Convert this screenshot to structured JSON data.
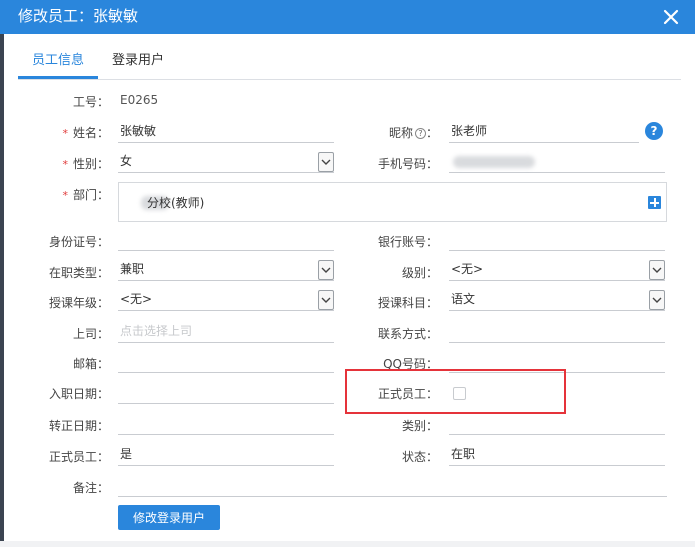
{
  "dialog": {
    "title": "修改员工：张敏敏"
  },
  "tabs": [
    {
      "label": "员工信息"
    },
    {
      "label": "登录用户"
    }
  ],
  "form": {
    "employee_no": {
      "label": "工号：",
      "value": "E0265"
    },
    "name": {
      "label": "姓名：",
      "value": "张敏敏"
    },
    "nickname": {
      "label": "昵称",
      "label_suffix": "：",
      "value": "张老师"
    },
    "gender": {
      "label": "性别：",
      "value": "女"
    },
    "phone": {
      "label": "手机号码：",
      "value": ""
    },
    "department": {
      "label": "部门：",
      "value": "分校(教师)"
    },
    "id_card": {
      "label": "身份证号：",
      "value": ""
    },
    "bank_account": {
      "label": "银行账号：",
      "value": ""
    },
    "job_type": {
      "label": "在职类型：",
      "value": "兼职"
    },
    "level": {
      "label": "级别：",
      "value": "<无>"
    },
    "teach_grade": {
      "label": "授课年级：",
      "value": "<无>"
    },
    "teach_subject": {
      "label": "授课科目：",
      "value": "语文"
    },
    "supervisor": {
      "label": "上司：",
      "placeholder": "点击选择上司"
    },
    "contact": {
      "label": "联系方式：",
      "value": ""
    },
    "email": {
      "label": "邮箱：",
      "value": ""
    },
    "qq": {
      "label": "QQ号码：",
      "value": ""
    },
    "hire_date": {
      "label": "入职日期：",
      "value": ""
    },
    "is_formal_check": {
      "label": "正式员工：",
      "checked": false
    },
    "confirm_date": {
      "label": "转正日期：",
      "value": ""
    },
    "category": {
      "label": "类别：",
      "value": ""
    },
    "is_formal": {
      "label": "正式员工：",
      "value": "是"
    },
    "status": {
      "label": "状态：",
      "value": "在职"
    },
    "remark": {
      "label": "备注：",
      "value": ""
    }
  },
  "required_mark": "*",
  "help_icon": "?",
  "buttons": {
    "edit_login_user": "修改登录用户"
  },
  "colors": {
    "primary": "#2a86dc",
    "required": "#e03b3b",
    "highlight": "#e5333a"
  }
}
